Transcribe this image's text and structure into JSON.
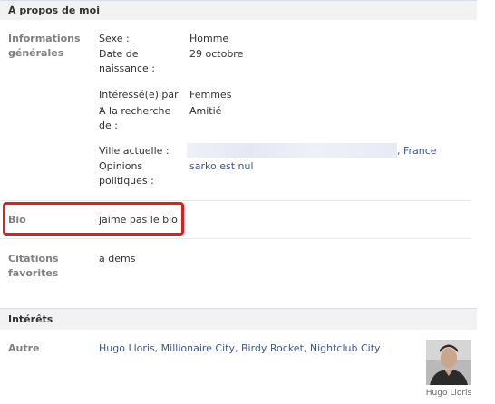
{
  "about": {
    "header": "À propos de moi",
    "general": {
      "label_line1": "Informations",
      "label_line2": "générales",
      "sex_label": "Sexe :",
      "sex_value": "Homme",
      "birthday_label_line1": "Date de",
      "birthday_label_line2": "naissance :",
      "birthday_value": "29 octobre",
      "interested_label": "Intéressé(e) par :",
      "interested_value": "Femmes",
      "looking_label_line1": "À la recherche",
      "looking_label_line2": "de :",
      "looking_value": "Amitié",
      "city_label": "Ville actuelle :",
      "city_value": ", France",
      "politics_label_line1": "Opinions",
      "politics_label_line2": "politiques :",
      "politics_value": "sarko est nul"
    },
    "bio": {
      "label": "Bio",
      "value": "jaime pas le bio"
    },
    "quotes": {
      "label_line1": "Citations",
      "label_line2": "favorites",
      "value": "a dems"
    }
  },
  "interests": {
    "header": "Intérêts",
    "other": {
      "label": "Autre",
      "items_text": "Hugo Lloris, Millionaire City, Birdy Rocket, Nightclub City",
      "thumbnail_caption": "Hugo Lloris"
    }
  },
  "colors": {
    "highlight": "#e41c1c",
    "link": "#3b5998",
    "header_bg": "#f2f2f2"
  }
}
